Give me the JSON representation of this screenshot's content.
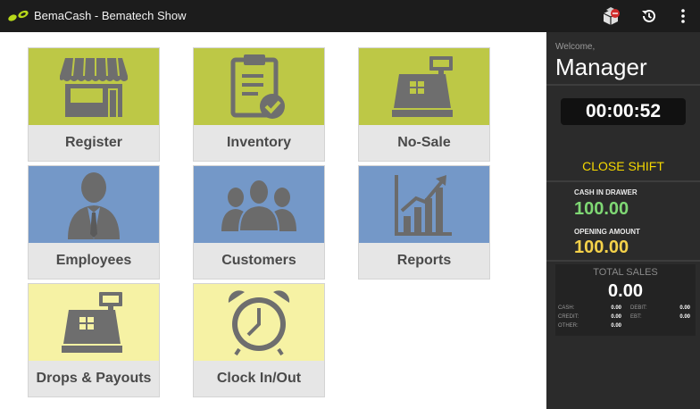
{
  "app": {
    "title": "BemaCash - Bematech Show",
    "logo_color": "#b7d81a",
    "topbar_color": "#1c1c1c"
  },
  "topbar_icons": [
    "box-notification-icon",
    "history-icon",
    "overflow-menu-icon"
  ],
  "tiles": [
    {
      "label": "Register",
      "icon": "storefront-icon",
      "color": "#bdc846"
    },
    {
      "label": "Inventory",
      "icon": "clipboard-check-icon",
      "color": "#bdc846"
    },
    {
      "label": "No-Sale",
      "icon": "cash-register-icon",
      "color": "#bdc846"
    },
    {
      "label": "Employees",
      "icon": "employee-icon",
      "color": "#7498c8"
    },
    {
      "label": "Customers",
      "icon": "customers-group-icon",
      "color": "#7498c8"
    },
    {
      "label": "Reports",
      "icon": "bar-chart-icon",
      "color": "#7498c8"
    },
    {
      "label": "Drops & Payouts",
      "icon": "cash-register-icon",
      "color": "#f6f2a4"
    },
    {
      "label": "Clock In/Out",
      "icon": "alarm-clock-icon",
      "color": "#f6f2a4"
    }
  ],
  "side": {
    "welcome": "Welcome,",
    "user": "Manager",
    "timer": "00:00:52",
    "close_shift": "CLOSE SHIFT",
    "cash_in_drawer_label": "CASH IN DRAWER",
    "cash_in_drawer": "100.00",
    "opening_amount_label": "OPENING AMOUNT",
    "opening_amount": "100.00",
    "total_sales_label": "TOTAL SALES",
    "total_sales": "0.00",
    "breakdown": {
      "cash_label": "CASH:",
      "cash": "0.00",
      "debit_label": "DEBIT:",
      "debit": "0.00",
      "credit_label": "CREDIT:",
      "credit": "0.00",
      "ebt_label": "EBT:",
      "ebt": "0.00",
      "other_label": "OTHER:",
      "other": "0.00"
    },
    "colors": {
      "cash": "#7fd874",
      "opening": "#f5d24a",
      "close_shift": "#f5d800"
    }
  }
}
